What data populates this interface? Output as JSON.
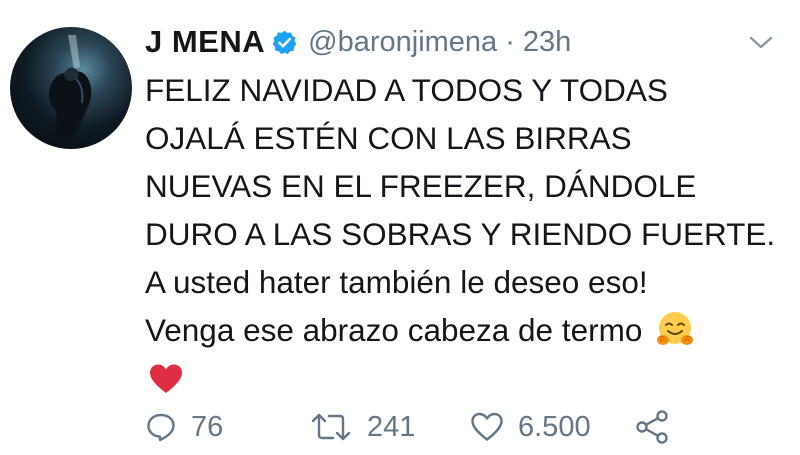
{
  "tweet": {
    "display_name": "J MENA",
    "handle": "@baronjimena",
    "separator": "·",
    "time": "23h",
    "verified": true,
    "text_lines": [
      "FELIZ NAVIDAD A TODOS Y TODAS",
      "OJALÁ ESTÉN CON LAS BIRRAS",
      "NUEVAS EN EL FREEZER, DÁNDOLE",
      "DURO A LAS SOBRAS Y RIENDO FUERTE.",
      "A usted hater también le deseo eso!",
      "Venga ese abrazo cabeza de termo"
    ],
    "emojis": [
      "hugging-face",
      "red-heart"
    ]
  },
  "actions": {
    "reply_count": "76",
    "retweet_count": "241",
    "like_count": "6.500"
  },
  "colors": {
    "text": "#14171a",
    "secondary": "#657786",
    "verified_blue": "#1da1f2",
    "heart_red": "#dd2e44",
    "emoji_yellow": "#ffcc4d"
  },
  "icons": [
    "avatar",
    "verified-badge-icon",
    "chevron-down-icon",
    "reply-icon",
    "retweet-icon",
    "like-icon",
    "share-icon"
  ]
}
